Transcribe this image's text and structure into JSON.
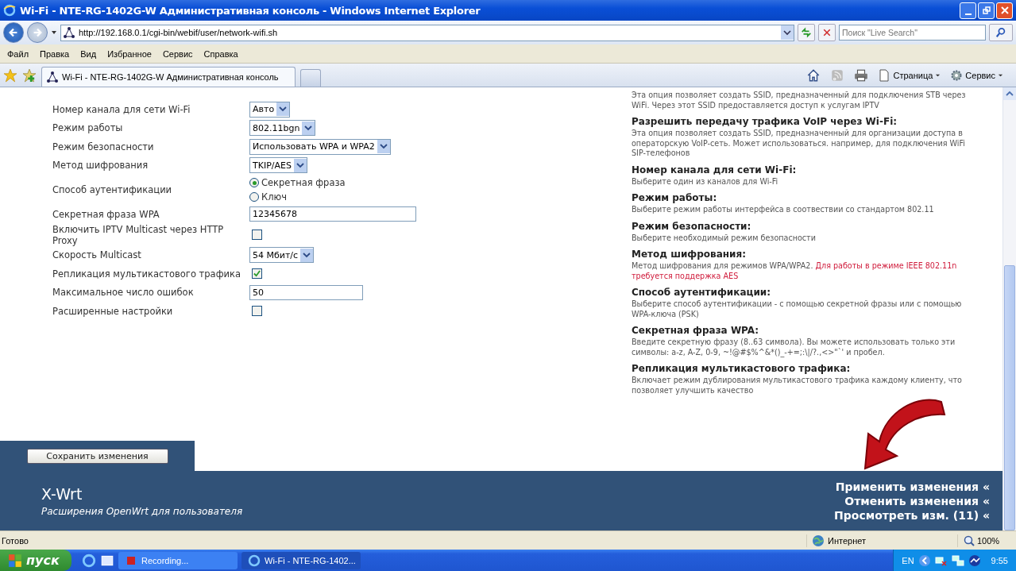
{
  "window": {
    "title": "Wi-Fi - NTE-RG-1402G-W Административная консоль - Windows Internet Explorer"
  },
  "address_bar": {
    "url": "http://192.168.0.1/cgi-bin/webif/user/network-wifi.sh",
    "search_placeholder": "Поиск \"Live Search\""
  },
  "menu": [
    "Файл",
    "Правка",
    "Вид",
    "Избранное",
    "Сервис",
    "Справка"
  ],
  "tabs": [
    {
      "label": "Wi-Fi - NTE-RG-1402G-W Административная консоль",
      "selected": true
    }
  ],
  "command_bar": [
    "Страница",
    "Сервис"
  ],
  "form": [
    {
      "kind": "select",
      "label": "Номер канала для сети Wi-Fi",
      "value": "Авто"
    },
    {
      "kind": "select",
      "label": "Режим работы",
      "value": "802.11bgn"
    },
    {
      "kind": "select",
      "label": "Режим безопасности",
      "value": "Использовать WPA и WPA2"
    },
    {
      "kind": "select",
      "label": "Метод шифрования",
      "value": "TKIP/AES"
    },
    {
      "kind": "radio",
      "label": "Способ аутентификации",
      "options": [
        {
          "label": "Секретная фраза",
          "selected": true
        },
        {
          "label": "Ключ",
          "selected": false
        }
      ]
    },
    {
      "kind": "text",
      "label": "Секретная фраза WPA",
      "value": "12345678",
      "wide": true
    },
    {
      "kind": "checkbox",
      "label": "Включить IPTV Multicast через HTTP Proxy",
      "checked": false
    },
    {
      "kind": "select",
      "label": "Скорость Multicast",
      "value": "54 Мбит/с"
    },
    {
      "kind": "checkbox",
      "label": "Репликация мультикастового трафика",
      "checked": true
    },
    {
      "kind": "text",
      "label": "Максимальное число ошибок",
      "value": "50",
      "wide": false
    },
    {
      "kind": "checkbox",
      "label": "Расширенные настройки",
      "checked": false
    }
  ],
  "help": [
    {
      "text": "Эта опция позволяет создать SSID, предназначенный для подключения STB через WiFi. Через этот SSID предоставляется доступ к услугам IPTV"
    },
    {
      "title": "Разрешить передачу трафика VoIP через Wi-Fi:",
      "text": "Эта опция позволяет создать SSID, предназначенный для организации доступа в операторскую VoIP-сеть. Может использоваться. например, для подключения WiFi SIP-телефонов"
    },
    {
      "title": "Номер канала для сети Wi-Fi:",
      "text": "Выберите один из каналов для Wi-Fi"
    },
    {
      "title": "Режим работы:",
      "text": "Выберите режим работы интерфейса в соотвествии со стандартом 802.11"
    },
    {
      "title": "Режим безопасности:",
      "text": "Выберите необходимый режим безопасности"
    },
    {
      "title": "Метод шифрования:",
      "text": "Метод шифрования для режимов WPA/WPA2.",
      "warning": "Для работы в режиме IEEE 802.11n требуется поддержка AES"
    },
    {
      "title": "Способ аутентификации:",
      "text": "Выберите способ аутентификации - с помощью секретной фразы или с помощью WPA-ключа (PSK)"
    },
    {
      "title": "Секретная фраза WPA:",
      "text": "Введите секретную фразу (8..63 символа). Вы можете использовать только эти символы: a-z, A-Z, 0-9, ~!@#$%^&*()_-+=;:\\|/?.,<>\"`' и пробел."
    },
    {
      "title": "Репликация мультикастового трафика:",
      "text": "Включает режим дублирования мультикастового трафика каждому клиенту, что позволяет улучшить качество"
    }
  ],
  "save_button": "Сохранить изменения",
  "footer": {
    "brand": "X-Wrt",
    "tagline": "Расширения OpenWrt для пользователя",
    "links": [
      "Применить изменения «",
      "Отменить изменения «",
      "Просмотреть изм. (11) «"
    ]
  },
  "status_bar": {
    "text": "Готово",
    "zone": "Интернет",
    "zoom": "100%"
  },
  "taskbar": {
    "start": "пуск",
    "tasks": [
      {
        "label": "Recording...",
        "selected": false
      },
      {
        "label": "Wi-Fi - NTE-RG-1402...",
        "selected": true
      }
    ],
    "lang": "EN",
    "clock": "9:55"
  }
}
